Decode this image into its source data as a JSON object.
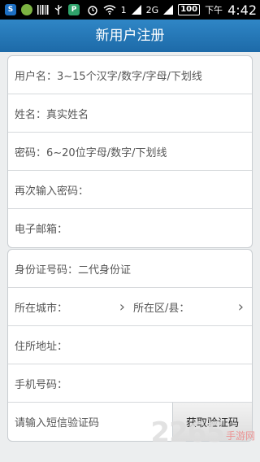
{
  "statusbar": {
    "left_icons": [
      "s-app-icon",
      "ball-app-icon",
      "barcode-icon",
      "usb-icon",
      "p-app-icon"
    ],
    "signal1": "1",
    "signal2": "2G",
    "battery": "100",
    "time_prefix": "下午",
    "time": "4:42"
  },
  "header": {
    "title": "新用户注册"
  },
  "form1": {
    "username_placeholder": "用户名：3~15个汉字/数字/字母/下划线",
    "name_placeholder": "姓名：真实姓名",
    "password_placeholder": "密码：6~20位字母/数字/下划线",
    "repeat_password_label": "再次输入密码：",
    "email_label": "电子邮箱："
  },
  "form2": {
    "id_placeholder": "身份证号码：二代身份证",
    "city_label": "所在城市：",
    "district_label": "所在区/县：",
    "address_label": "住所地址：",
    "phone_label": "手机号码：",
    "sms_placeholder": "请输入短信验证码",
    "sms_button": "获取验证码"
  },
  "watermark": {
    "number": "2265",
    "site": "手游网"
  },
  "colors": {
    "header": "#1d6aa8",
    "background": "#eceeef"
  }
}
